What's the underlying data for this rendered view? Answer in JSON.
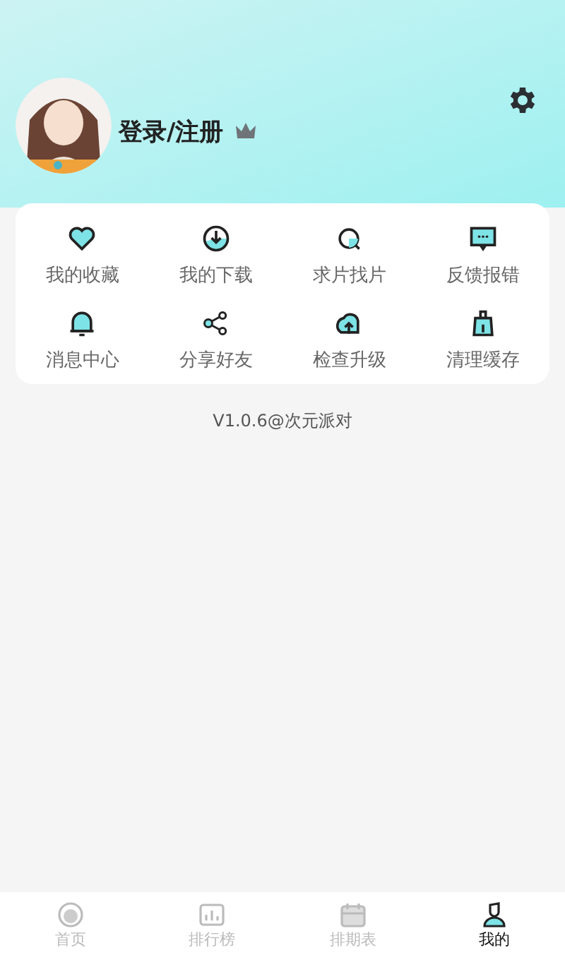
{
  "profile": {
    "login_label": "登录/注册"
  },
  "menu": [
    {
      "label": "我的收藏"
    },
    {
      "label": "我的下载"
    },
    {
      "label": "求片找片"
    },
    {
      "label": "反馈报错"
    },
    {
      "label": "消息中心"
    },
    {
      "label": "分享好友"
    },
    {
      "label": "检查升级"
    },
    {
      "label": "清理缓存"
    }
  ],
  "version": "V1.0.6@次元派对",
  "tabs": [
    {
      "label": "首页",
      "selected": false
    },
    {
      "label": "排行榜",
      "selected": false
    },
    {
      "label": "排期表",
      "selected": false
    },
    {
      "label": "我的",
      "selected": true
    }
  ]
}
